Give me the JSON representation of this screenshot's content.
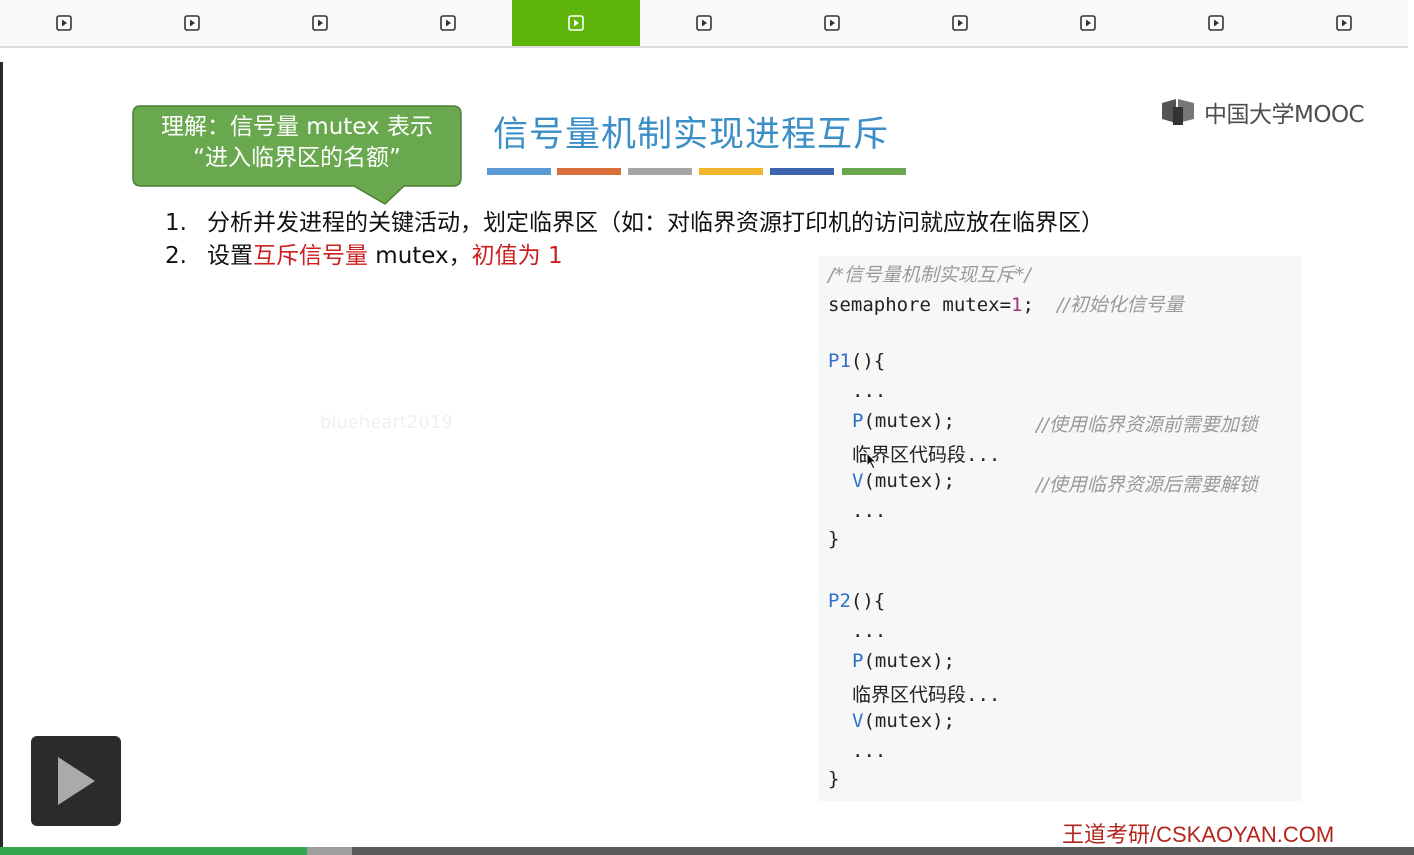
{
  "nav": {
    "segment_count": 11,
    "active_index": 4
  },
  "callout": {
    "line1": "理解：信号量 mutex 表示",
    "line2": "“进入临界区的名额”"
  },
  "slide_title": "信号量机制实现进程互斥",
  "logo_text": "中国大学MOOC",
  "list": {
    "item1_num": "1.",
    "item1_text": "分析并发进程的关键活动，划定临界区（如：对临界资源打印机的访问就应放在临界区）",
    "item2_num": "2.",
    "item2_pre": "设置",
    "item2_red1": "互斥信号量",
    "item2_mid": " mutex，",
    "item2_red2": "初值为 1"
  },
  "watermark": "blueheart2019",
  "code": {
    "c1": "/*信号量机制实现互斥*/",
    "c2a": "semaphore mutex=",
    "c2num": "1",
    "c2b": ";  ",
    "c2cmt": "//初始化信号量",
    "p1": "P1",
    "p1b": "(){",
    "dots": "...",
    "P": "P",
    "V": "V",
    "pm": "(mutex);",
    "pmcmt": "//使用临界资源前需要加锁",
    "crit": "临界区代码段...",
    "vm": "(mutex);",
    "vmcmt": "//使用临界资源后需要解锁",
    "close": "}",
    "p2": "P2",
    "p2b": "(){"
  },
  "brand": "王道考研/CSKAOYAN.COM",
  "progress": {
    "played_fraction": 0.217,
    "buffered_fraction": 0.249
  },
  "colors": {
    "active_segment": "#5fb40a",
    "title": "#3b8fc6",
    "callout_fill": "#6aa84f",
    "highlight_red": "#cc1f1f",
    "bars": [
      "#5b9bd5",
      "#d9703b",
      "#a5a5a5",
      "#f1b52e",
      "#3e64b0",
      "#6aa84f"
    ]
  },
  "icons": [
    "play-square-icon",
    "mooc-logo-icon",
    "mouse-cursor-icon",
    "play-icon"
  ]
}
